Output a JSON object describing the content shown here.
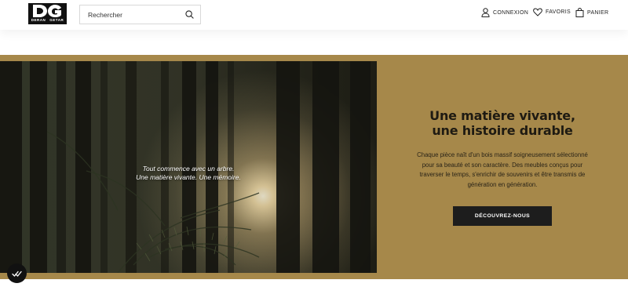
{
  "header": {
    "logo_letters": "DG",
    "logo_words": [
      "DERAN",
      "GETAR"
    ],
    "search": {
      "placeholder": "Rechercher",
      "value": "",
      "icon": "search-icon"
    },
    "nav": [
      {
        "label": "CONNEXION",
        "icon": "user-icon"
      },
      {
        "label": "FAVORIS",
        "icon": "heart-icon"
      },
      {
        "label": "PANIER",
        "icon": "shopping-bag-icon"
      }
    ]
  },
  "hero": {
    "caption_line1": "Tout commence avec un arbre.",
    "caption_line2": "Une matière vivante. Une mémoire.",
    "title_line1": "Une matière vivante,",
    "title_line2": "une histoire durable",
    "text": "Chaque pièce naît d'un bois massif soigneusement sélectionné pour sa beauté et son caractère. Des meubles conçus pour traverser le temps, s'enrichir de souvenirs et être transmis de génération en génération.",
    "button_label": "DÉCOUVREZ-NOUS"
  },
  "colors": {
    "accent": "#a6884a",
    "button": "#1d1d1d",
    "forest": "#2b2a1f"
  },
  "badge": {
    "icon": "double-check-icon"
  }
}
